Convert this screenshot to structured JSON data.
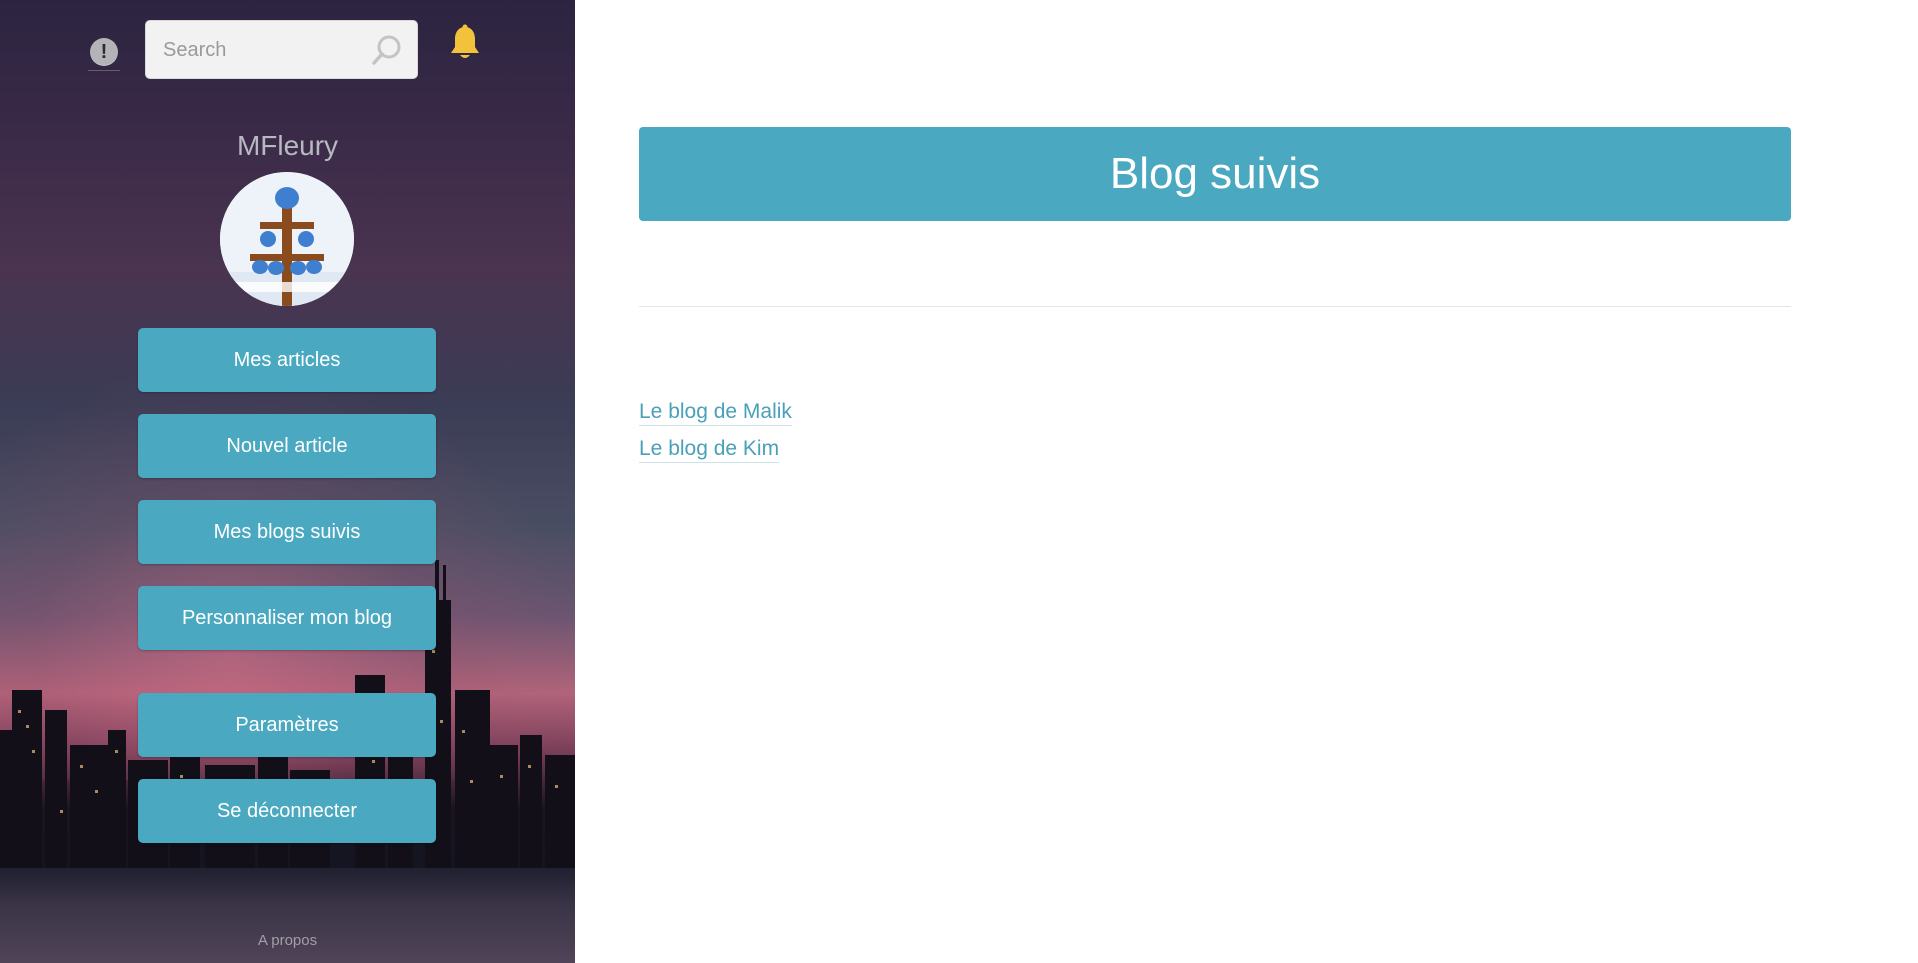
{
  "sidebar": {
    "search_placeholder": "Search",
    "warning_symbol": "!",
    "username": "MFleury",
    "nav": [
      {
        "label": "Mes articles"
      },
      {
        "label": "Nouvel article"
      },
      {
        "label": "Mes blogs suivis"
      },
      {
        "label": "Personnaliser mon blog"
      },
      {
        "label": "Paramètres"
      },
      {
        "label": "Se déconnecter"
      }
    ],
    "about": "A propos",
    "icons": {
      "search": "search-icon",
      "notifications": "bell-icon",
      "alert": "alert-icon"
    }
  },
  "main": {
    "title": "Blog suivis",
    "blogs": [
      {
        "label": "Le blog de Malik"
      },
      {
        "label": "Le blog de Kim"
      }
    ]
  },
  "colors": {
    "accent": "#4aa8c0",
    "link": "#4aa0b8",
    "bell": "#f2c23a"
  }
}
